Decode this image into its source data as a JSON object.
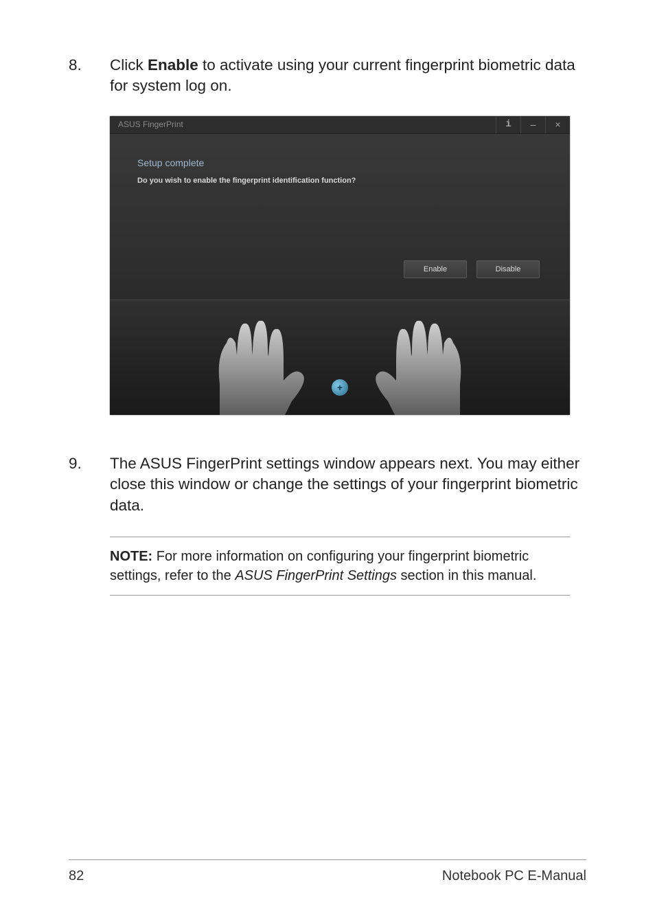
{
  "step8": {
    "num": "8.",
    "prefix": "Click ",
    "bold": "Enable",
    "suffix": " to activate using your current fingerprint biometric data for system log on."
  },
  "dialog": {
    "title": "ASUS FingerPrint",
    "info_symbol": "i",
    "min_symbol": "–",
    "close_symbol": "×",
    "heading": "Setup complete",
    "subheading": "Do you wish to enable the fingerprint identification function?",
    "enable_btn": "Enable",
    "disable_btn": "Disable",
    "plus_symbol": "+"
  },
  "step9": {
    "num": "9.",
    "text": "The ASUS FingerPrint settings window appears next. You may either close this window or change the settings of your fingerprint biometric data."
  },
  "note": {
    "label": "NOTE:",
    "prefix": " For more information on configuring your fingerprint biometric settings, refer to the ",
    "italic": "ASUS FingerPrint Settings",
    "suffix": " section in this manual."
  },
  "footer": {
    "page": "82",
    "title": "Notebook PC E-Manual"
  }
}
